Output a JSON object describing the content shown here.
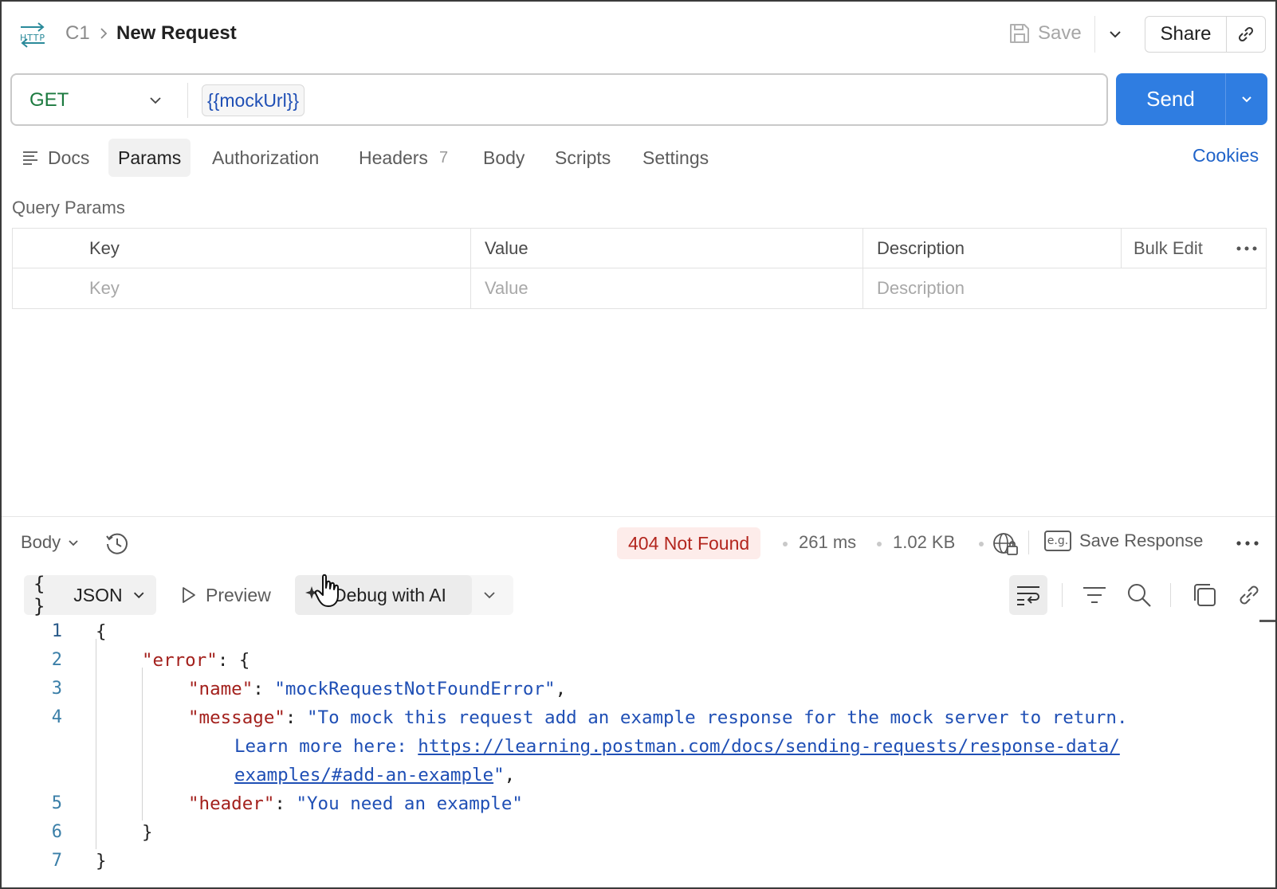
{
  "header": {
    "breadcrumb_parent": "C1",
    "title": "New Request",
    "save_label": "Save",
    "share_label": "Share"
  },
  "request": {
    "method": "GET",
    "url": "{{mockUrl}}",
    "send_label": "Send"
  },
  "tabs": [
    {
      "label": "Docs"
    },
    {
      "label": "Params",
      "active": true
    },
    {
      "label": "Authorization"
    },
    {
      "label": "Headers",
      "count": "7"
    },
    {
      "label": "Body"
    },
    {
      "label": "Scripts"
    },
    {
      "label": "Settings"
    }
  ],
  "cookies_label": "Cookies",
  "query_params": {
    "title": "Query Params",
    "columns": [
      "Key",
      "Value",
      "Description"
    ],
    "bulk_edit_label": "Bulk Edit",
    "placeholders": [
      "Key",
      "Value",
      "Description"
    ]
  },
  "response": {
    "view_label": "Body",
    "status": "404 Not Found",
    "time": "261 ms",
    "size": "1.02 KB",
    "save_response_label": "Save Response",
    "eg_label": "e.g.",
    "format_label": "JSON",
    "format_braces": "{ }",
    "preview_label": "Preview",
    "debug_label": "Debug with AI"
  },
  "code": {
    "line_numbers": [
      "1",
      "2",
      "3",
      "4",
      "5",
      "6",
      "7"
    ],
    "open_brace": "{",
    "error_key": "\"error\"",
    "error_open": ": {",
    "name_key": "\"name\"",
    "name_value": "\"mockRequestNotFoundError\"",
    "message_key": "\"message\"",
    "message_value_1": "\"To mock this request add an example response for the mock server to return.",
    "message_value_2": "Learn more here: ",
    "message_url_1": "https://learning.postman.com/docs/sending-requests/response-data/",
    "message_url_2": "examples/#add-an-example",
    "message_close": "\"",
    "header_key": "\"header\"",
    "header_value": "\"You need an example\"",
    "inner_close": "}",
    "outer_close": "}"
  },
  "colors": {
    "accent": "#2f7de1",
    "method_get": "#1c7a3f",
    "status_error": "#b3261e",
    "json_key": "#a3201c",
    "json_string": "#1f4fb5"
  },
  "icons": [
    "http-icon",
    "chevron-right-icon",
    "save-icon",
    "chevron-down-icon",
    "link-icon",
    "docs-icon",
    "history-icon",
    "globe-lock-icon",
    "more-icon",
    "play-icon",
    "sparkle-icon",
    "cursor-icon",
    "wrap-icon",
    "filter-icon",
    "search-icon",
    "copy-icon"
  ]
}
